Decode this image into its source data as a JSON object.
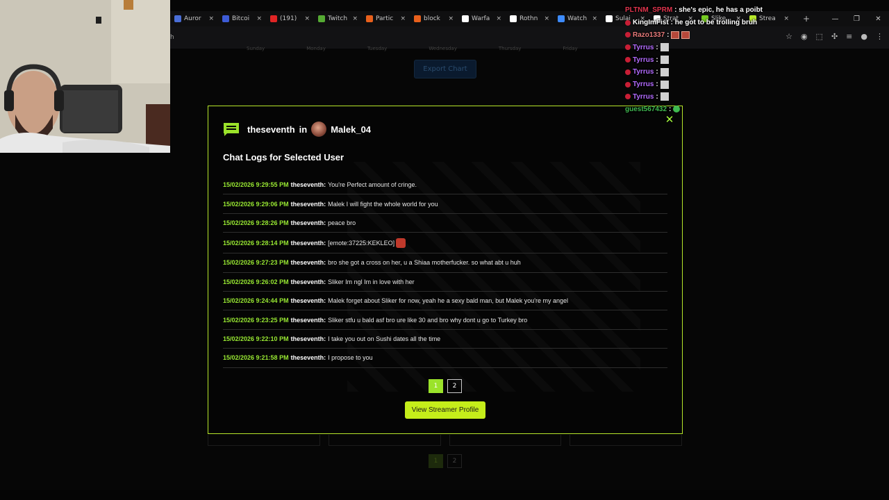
{
  "browser": {
    "tabs": [
      {
        "label": "Auror",
        "icon_color": "#4a6ed6"
      },
      {
        "label": "Bitcoi",
        "icon_color": "#3d5bd6"
      },
      {
        "label": "(191)",
        "icon_color": "#e02424"
      },
      {
        "label": "Twitch",
        "icon_color": "#55aa33"
      },
      {
        "label": "Partic",
        "icon_color": "#e8601c"
      },
      {
        "label": "block",
        "icon_color": "#e8601c"
      },
      {
        "label": "Warfa",
        "icon_color": "#ffffff"
      },
      {
        "label": "Rothn",
        "icon_color": "#ffffff"
      },
      {
        "label": "Watch",
        "icon_color": "#3d8bfd"
      },
      {
        "label": "Sulai",
        "icon_color": "#ffffff"
      },
      {
        "label": "Strat",
        "icon_color": "#ffffff"
      },
      {
        "label": "Slike",
        "icon_color": "#77cc22"
      },
      {
        "label": "Strea",
        "icon_color": "#b7e82a"
      }
    ],
    "tab_close": "×",
    "new_tab": "+",
    "window_controls": {
      "minimize": "—",
      "maximize": "❐",
      "close": "✕"
    },
    "address": "h",
    "bookmarks": [
      "Sunday",
      "Monday",
      "Tuesday",
      "Wednesday",
      "Thursday",
      "Friday"
    ]
  },
  "background": {
    "export_label": "Export Chart",
    "pager": [
      "1",
      "2"
    ]
  },
  "modal": {
    "username": "theseventh",
    "in_word": "in",
    "channel": "Malek_04",
    "close_glyph": "✕",
    "title": "Chat Logs for Selected User",
    "logs": [
      {
        "timestamp": "15/02/2026 9:29:55 PM",
        "user": "theseventh:",
        "message": "You're Perfect amount of cringe."
      },
      {
        "timestamp": "15/02/2026 9:29:06 PM",
        "user": "theseventh:",
        "message": "Malek I will fight the whole world for you"
      },
      {
        "timestamp": "15/02/2026 9:28:26 PM",
        "user": "theseventh:",
        "message": "peace bro"
      },
      {
        "timestamp": "15/02/2026 9:28:14 PM",
        "user": "theseventh:",
        "message": "[emote:37225:KEKLEO]",
        "emote": true
      },
      {
        "timestamp": "15/02/2026 9:27:23 PM",
        "user": "theseventh:",
        "message": "bro she got a cross on her, u a Shiaa motherfucker. so what abt u huh"
      },
      {
        "timestamp": "15/02/2026 9:26:02 PM",
        "user": "theseventh:",
        "message": "Sliker Im ngl Im in love with her"
      },
      {
        "timestamp": "15/02/2026 9:24:44 PM",
        "user": "theseventh:",
        "message": "Malek forget about Sliker for now, yeah he a sexy bald man, but Malek you're my angel"
      },
      {
        "timestamp": "15/02/2026 9:23:25 PM",
        "user": "theseventh:",
        "message": "Sliker stfu u bald asf bro ure like 30 and bro why dont u go to Turkey bro"
      },
      {
        "timestamp": "15/02/2026 9:22:10 PM",
        "user": "theseventh:",
        "message": "I take you out on Sushi dates all the time"
      },
      {
        "timestamp": "15/02/2026 9:21:58 PM",
        "user": "theseventh:",
        "message": "I propose to you"
      }
    ],
    "pages": [
      {
        "label": "1",
        "active": true
      },
      {
        "label": "2",
        "active": false
      }
    ],
    "view_profile_label": "View Streamer Profile"
  },
  "stream_chat": [
    {
      "name": "PLTNM_SPRM",
      "message": " : she's epic, he has a poibt",
      "color": "#e0344d",
      "badge": false,
      "emote": ""
    },
    {
      "name": "KingImFist",
      "message": " : he got to be trolling bruh",
      "color": "#ffffff",
      "badge": true,
      "emote": ""
    },
    {
      "name": "Razo1337",
      "message": " :",
      "color": "#e87b7b",
      "badge": true,
      "emote": "double"
    },
    {
      "name": "Tyrrus",
      "message": " :",
      "color": "#b36bff",
      "badge": true,
      "emote": "gray"
    },
    {
      "name": "Tyrrus",
      "message": " :",
      "color": "#b36bff",
      "badge": true,
      "emote": "gray"
    },
    {
      "name": "Tyrrus",
      "message": " :",
      "color": "#b36bff",
      "badge": true,
      "emote": "gray"
    },
    {
      "name": "Tyrrus",
      "message": " :",
      "color": "#b36bff",
      "badge": true,
      "emote": "gray"
    },
    {
      "name": "Tyrrus",
      "message": " :",
      "color": "#b36bff",
      "badge": true,
      "emote": "gray"
    },
    {
      "name": "guest567432",
      "message": " :",
      "color": "#3fb950",
      "badge": false,
      "emote": "green"
    }
  ]
}
